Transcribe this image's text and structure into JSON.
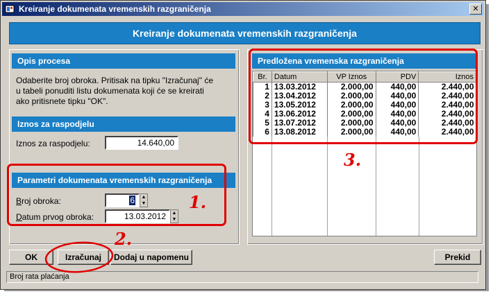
{
  "window": {
    "title": "Kreiranje dokumenata vremenskih razgraničenja",
    "close_glyph": "✕"
  },
  "banner": "Kreiranje dokumenata vremenskih razgraničenja",
  "left": {
    "opis": {
      "header": "Opis procesa",
      "lines": [
        "Odaberite broj obroka. Pritisak na tipku \"Izračunaj\" će",
        "u tabeli ponuditi listu dokumenata koji će se kreirati",
        "ako pritisnete tipku \"OK\"."
      ]
    },
    "iznos": {
      "header": "Iznos za raspodjelu",
      "label": "Iznos za raspodjelu:",
      "value": "14.640,00"
    },
    "parametri": {
      "header": "Parametri dokumenata vremenskih razgraničenja",
      "broj_label": "Broj obroka:",
      "broj_value": "6",
      "datum_label": "Datum prvog obroka:",
      "datum_value": "13.03.2012"
    }
  },
  "right": {
    "header": "Predložena vremenska razgraničenja",
    "columns": [
      "Br.",
      "Datum",
      "VP Iznos",
      "PDV",
      "Iznos"
    ],
    "rows": [
      [
        "1",
        "13.03.2012",
        "2.000,00",
        "440,00",
        "2.440,00"
      ],
      [
        "2",
        "13.04.2012",
        "2.000,00",
        "440,00",
        "2.440,00"
      ],
      [
        "3",
        "13.05.2012",
        "2.000,00",
        "440,00",
        "2.440,00"
      ],
      [
        "4",
        "13.06.2012",
        "2.000,00",
        "440,00",
        "2.440,00"
      ],
      [
        "5",
        "13.07.2012",
        "2.000,00",
        "440,00",
        "2.440,00"
      ],
      [
        "6",
        "13.08.2012",
        "2.000,00",
        "440,00",
        "2.440,00"
      ]
    ]
  },
  "buttons": {
    "ok": "OK",
    "izracunaj": "Izračunaj",
    "dodaj": "Dodaj u napomenu",
    "prekid": "Prekid"
  },
  "status": "Broj rata plaćanja",
  "annotations": {
    "one": "1.",
    "two": "2.",
    "three": "3."
  },
  "colors": {
    "accent": "#1a7fc5",
    "annotation": "#e00000"
  }
}
